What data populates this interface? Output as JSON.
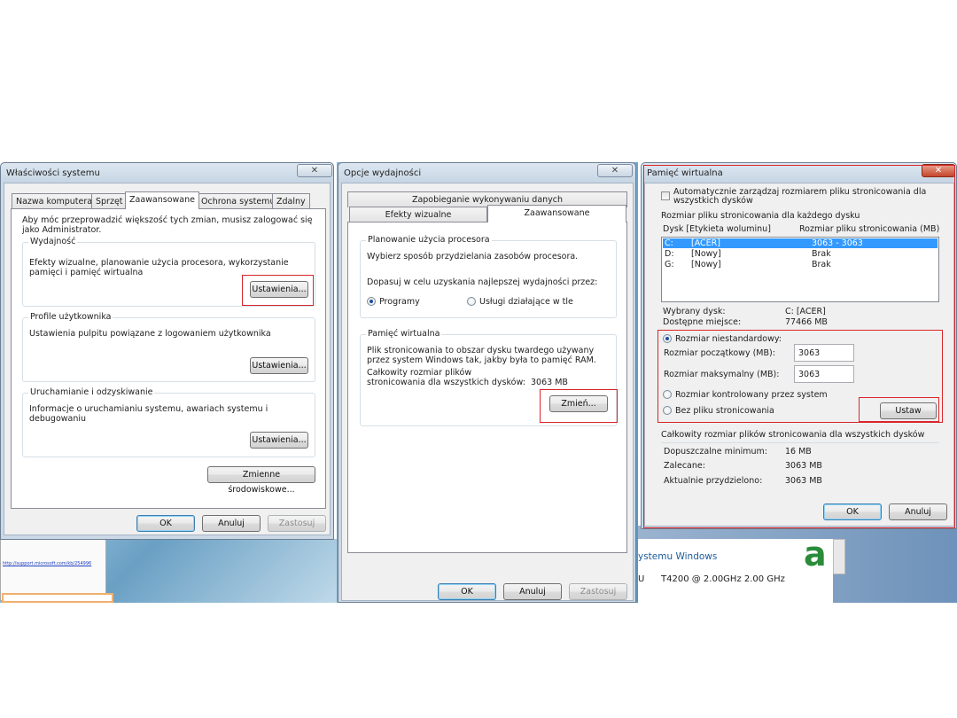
{
  "colors": {
    "highlight": "#d9252a",
    "selection": "#3399ff",
    "accent": "#2a8c3b"
  },
  "window1": {
    "title": "Właściwości systemu",
    "close": "✕",
    "tabs": [
      "Nazwa komputera",
      "Sprzęt",
      "Zaawansowane",
      "Ochrona systemu",
      "Zdalny"
    ],
    "admin_note": "Aby móc przeprowadzić większość tych zmian, musisz zalogować się jako Administrator.",
    "groups": [
      {
        "label": "Wydajność",
        "desc": "Efekty wizualne, planowanie użycia procesora, wykorzystanie pamięci i pamięć wirtualna",
        "button": "Ustawienia..."
      },
      {
        "label": "Profile użytkownika",
        "desc": "Ustawienia pulpitu powiązane z logowaniem użytkownika",
        "button": "Ustawienia..."
      },
      {
        "label": "Uruchamianie i odzyskiwanie",
        "desc": "Informacje o uruchamianiu systemu, awariach systemu i debugowaniu",
        "button": "Ustawienia..."
      }
    ],
    "env_button": "Zmienne środowiskowe...",
    "ok": "OK",
    "cancel": "Anuluj",
    "apply": "Zastosuj",
    "behind_link": "http://support.microsoft.com/kb/254996"
  },
  "window2": {
    "title": "Opcje wydajności",
    "close": "✕",
    "tabs_back": "Zapobieganie wykonywaniu danych",
    "tabs": [
      "Efekty wizualne",
      "Zaawansowane"
    ],
    "cpu": {
      "label": "Planowanie użycia procesora",
      "desc": "Wybierz sposób przydzielania zasobów procesora.",
      "adjust": "Dopasuj w celu uzyskania najlepszej wydajności przez:",
      "opt1": "Programy",
      "opt2": "Usługi działające w tle"
    },
    "vm": {
      "label": "Pamięć wirtualna",
      "desc": "Plik stronicowania to obszar dysku twardego używany przez system Windows tak, jakby była to pamięć RAM.",
      "total_label": "Całkowity rozmiar plików stronicowania dla wszystkich dysków:",
      "total_value": "3063 MB",
      "button": "Zmień..."
    },
    "ok": "OK",
    "cancel": "Anuluj",
    "apply": "Zastosuj"
  },
  "window3": {
    "title": "Pamięć wirtualna",
    "close": "✕",
    "auto_manage": "Automatycznie zarządzaj rozmiarem pliku stronicowania dla wszystkich dysków",
    "section1": "Rozmiar pliku stronicowania dla każdego dysku",
    "col_drive": "Dysk [Etykieta woluminu]",
    "col_size": "Rozmiar pliku stronicowania (MB)",
    "drives": [
      {
        "drive": "C:",
        "label": "[ACER]",
        "size": "3063 - 3063"
      },
      {
        "drive": "D:",
        "label": "[Nowy]",
        "size": "Brak"
      },
      {
        "drive": "G:",
        "label": "[Nowy]",
        "size": "Brak"
      }
    ],
    "selected_drive_label": "Wybrany dysk:",
    "selected_drive_value": "C:  [ACER]",
    "free_space_label": "Dostępne miejsce:",
    "free_space_value": "77466  MB",
    "custom_size": "Rozmiar niestandardowy:",
    "initial_label": "Rozmiar początkowy (MB):",
    "initial_value": "3063",
    "max_label": "Rozmiar maksymalny (MB):",
    "max_value": "3063",
    "system_managed": "Rozmiar kontrolowany przez system",
    "no_paging": "Bez pliku stronicowania",
    "set_button": "Ustaw",
    "section2": "Całkowity rozmiar plików stronicowania dla wszystkich dysków",
    "min_label": "Dopuszczalne minimum:",
    "min_value": "16 MB",
    "rec_label": "Zalecane:",
    "rec_value": "3063 MB",
    "cur_label": "Aktualnie przydzielono:",
    "cur_value": "3063 MB",
    "ok": "OK",
    "cancel": "Anuluj"
  },
  "behind": {
    "system_windows": "ystemu Windows",
    "cpu_info": "T4200  @ 2.00GHz   2.00 GHz",
    "logo_letter": "a",
    "left_u": "U"
  }
}
